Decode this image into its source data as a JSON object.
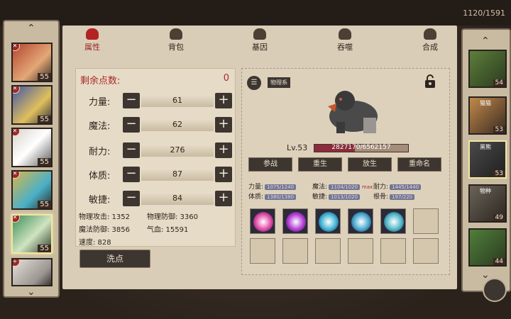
{
  "topbar": {
    "resource": "1120/1591"
  },
  "tabs": [
    {
      "label": "属性",
      "icon": "flame-icon",
      "active": true
    },
    {
      "label": "背包",
      "icon": "bag-icon",
      "active": false
    },
    {
      "label": "基因",
      "icon": "gene-icon",
      "active": false
    },
    {
      "label": "吞噬",
      "icon": "devour-icon",
      "active": false
    },
    {
      "label": "合成",
      "icon": "craft-icon",
      "active": false
    }
  ],
  "points": {
    "label": "剩余点数:",
    "value": "0"
  },
  "stats": [
    {
      "label": "力量:",
      "value": "61"
    },
    {
      "label": "魔法:",
      "value": "62"
    },
    {
      "label": "耐力:",
      "value": "276"
    },
    {
      "label": "体质:",
      "value": "87"
    },
    {
      "label": "敏捷:",
      "value": "84"
    }
  ],
  "sub_stats": {
    "phys_atk": "物理攻击: 1352",
    "phys_def": "物理防御: 3360",
    "mag_def": "魔法防御: 3856",
    "hp": "气血: 15591",
    "speed": "速度: 828"
  },
  "reset_button": "洗点",
  "pet": {
    "school_tag": "物理系",
    "level": "Lv.53",
    "hp_text": "2827170/6562157",
    "hp_fraction": 0.43
  },
  "actions": [
    "参战",
    "重生",
    "放生",
    "重命名"
  ],
  "detail_stats": {
    "str_label": "力量:",
    "str_val": "1075/1240",
    "mag_label": "魔法:",
    "mag_val": "1104/1020",
    "mag_max": "max",
    "end_label": "耐力:",
    "end_val": "1445/1440",
    "con_label": "体质:",
    "con_val": "1380/1380",
    "agi_label": "敏捷:",
    "agi_val": "1013/1020",
    "root_label": "根骨:",
    "root_val": "197/220"
  },
  "left_heroes": [
    {
      "level": "55",
      "color": "#b5452f"
    },
    {
      "level": "55",
      "color": "#4457a6"
    },
    {
      "level": "55",
      "color": "#d9d4cc"
    },
    {
      "level": "55",
      "color": "#d6b64a"
    },
    {
      "level": "55",
      "color": "#3f8f5a"
    },
    {
      "level": "",
      "color": "#e6e0d8"
    }
  ],
  "right_heroes": [
    {
      "level": "54",
      "name": "",
      "color": "#5d7f3a"
    },
    {
      "level": "53",
      "name": "猫猫",
      "color": "#c18a4a"
    },
    {
      "level": "53",
      "name": "黑熊",
      "color": "#4a4a4a"
    },
    {
      "level": "49",
      "name": "物种",
      "color": "#6b6358"
    },
    {
      "level": "44",
      "name": "",
      "color": "#4f7f3a"
    }
  ],
  "gem_colors": [
    "#e24aa8",
    "#b53bd6",
    "#3fb3d6",
    "#48a8d0",
    "#4fb7c9"
  ]
}
